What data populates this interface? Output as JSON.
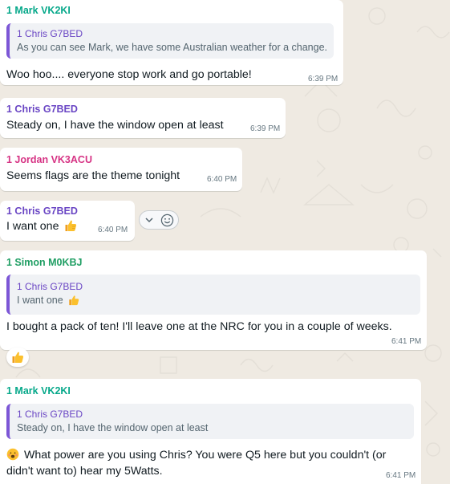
{
  "colors": {
    "sender_teal": "#06a88a",
    "sender_purple": "#6a46c4",
    "sender_pink": "#d63384",
    "sender_green": "#1f9e63",
    "quote_bar": "#7c56d6"
  },
  "messages": [
    {
      "sender": "1 Mark VK2KI",
      "quote": {
        "sender": "1 Chris G7BED",
        "text": "As you can see Mark, we have some Australian weather for a change."
      },
      "text": "Woo hoo.... everyone stop work and go portable!",
      "time": "6:39 PM"
    },
    {
      "sender": "1 Chris G7BED",
      "text": "Steady on, I have the window open at least",
      "time": "6:39 PM"
    },
    {
      "sender": "1 Jordan VK3ACU",
      "text": "Seems flags are the theme tonight",
      "time": "6:40 PM"
    },
    {
      "sender": "1 Chris G7BED",
      "text": "I want one",
      "emoji": "thumbs-up-emoji",
      "time": "6:40 PM"
    },
    {
      "sender": "1 Simon M0KBJ",
      "quote": {
        "sender": "1 Chris G7BED",
        "text": "I want one",
        "emoji": "thumbs-up-emoji"
      },
      "text": "I bought a pack of ten! I'll leave one at the NRC for you in a couple of weeks.",
      "time": "6:41 PM",
      "reaction": "thumbs-up-emoji"
    },
    {
      "sender": "1 Mark VK2KI",
      "quote": {
        "sender": "1 Chris G7BED",
        "text": "Steady on, I have the window open at least"
      },
      "lead_emoji": "smiling-face-emoji",
      "text_line1": "What power are you using Chris? You were Q5 here but you couldn't (or",
      "text_line2": "didn't want to) hear my 5Watts.",
      "time": "6:41 PM"
    }
  ],
  "message_controls": {
    "menu_icon": "chevron-down-icon",
    "react_icon": "emoji-smile-icon"
  }
}
